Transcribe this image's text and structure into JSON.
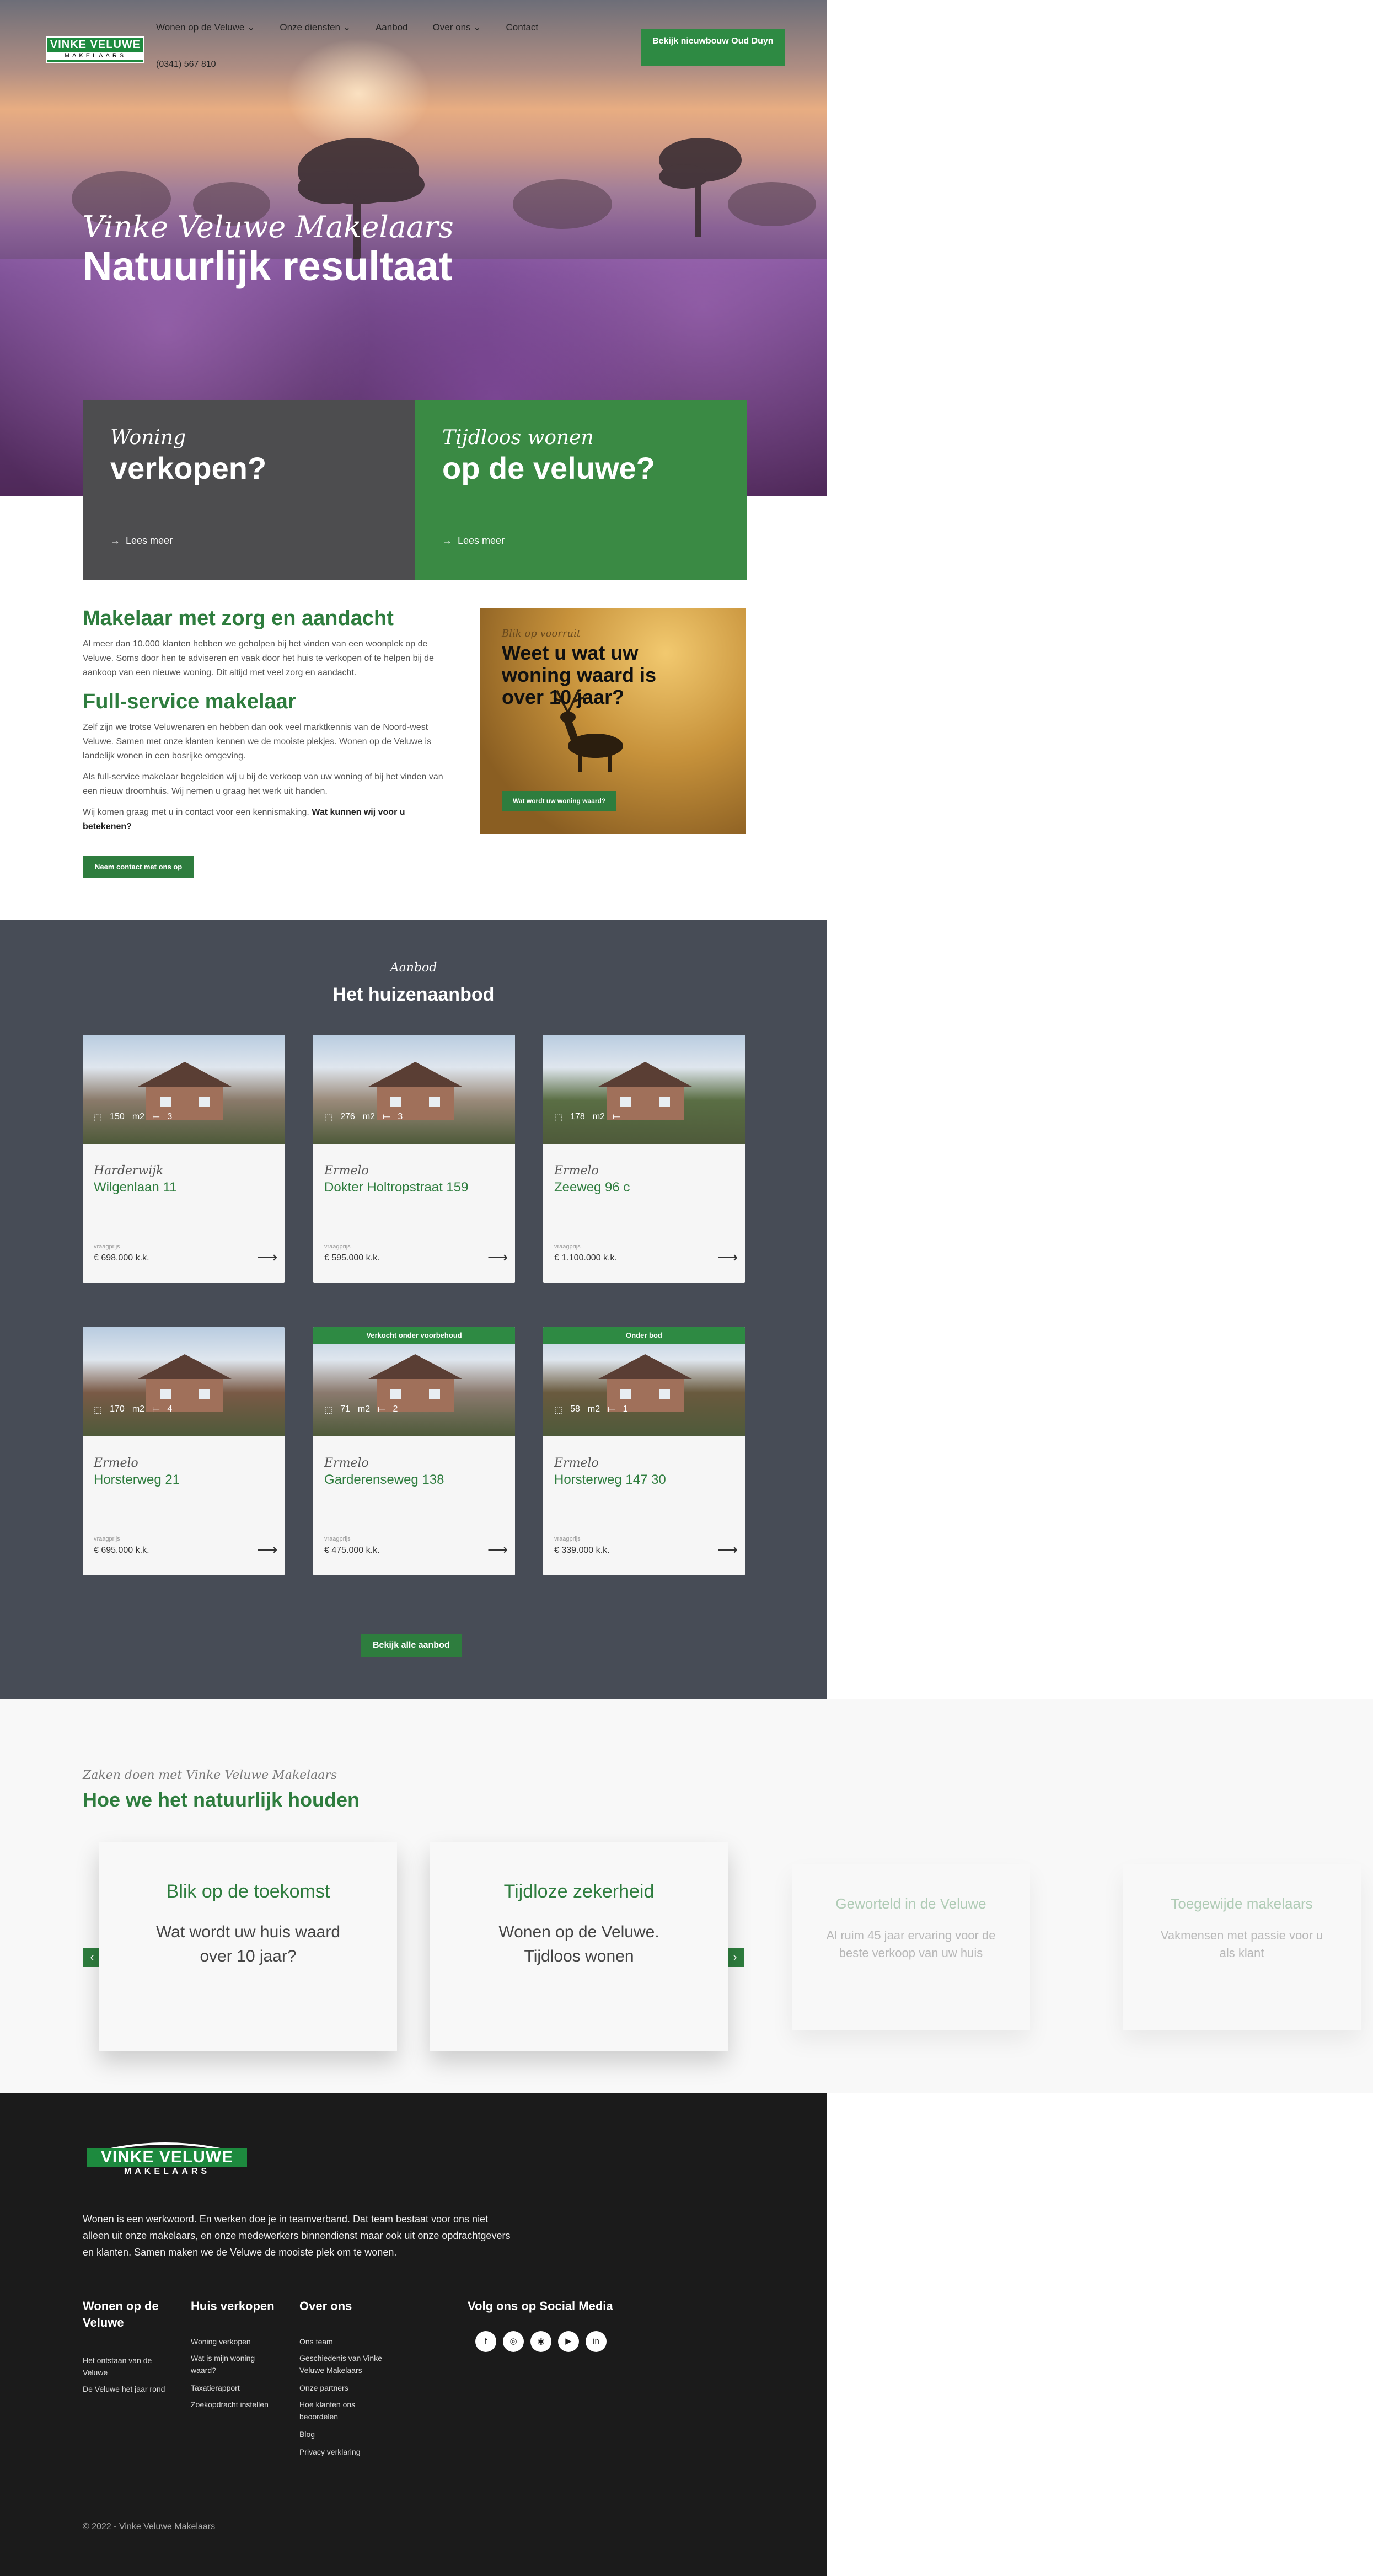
{
  "nav": {
    "logo": {
      "main": "VINKE VELUWE",
      "sub": "MAKELAARS"
    },
    "items": [
      "Wonen op de Veluwe",
      "Onze diensten",
      "Aanbod",
      "Over ons",
      "Contact"
    ],
    "phone": "(0341) 567 810",
    "cta": "Bekijk nieuwbouw Oud Duyn"
  },
  "hero": {
    "subtitle": "Vinke Veluwe Makelaars",
    "title": "Natuurlijk resultaat"
  },
  "boxes": [
    {
      "s": "Woning",
      "t": "verkopen?",
      "link": "Lees meer",
      "color": "#4d4d4f"
    },
    {
      "s": "Tijdloos wonen",
      "t": "op de veluwe?",
      "link": "Lees meer",
      "color": "#3a8a44"
    }
  ],
  "about": {
    "h1": "Makelaar met zorg en aandacht",
    "p1": "Al meer dan 10.000 klanten hebben we geholpen bij het vinden van een woonplek op de Veluwe. Soms door hen te adviseren en vaak door het huis te verkopen of te helpen bij de aankoop van een nieuwe woning. Dit altijd met veel zorg en aandacht.",
    "h2": "Full-service makelaar",
    "p2": "Zelf zijn we trotse Veluwenaren en hebben dan ook veel marktkennis van de Noord-west Veluwe. Samen met onze klanten kennen we de mooiste plekjes. Wonen op de Veluwe is landelijk wonen in een bosrijke omgeving.",
    "p3": "Als full-service makelaar begeleiden wij u bij de verkoop van uw woning of bij het vinden van een nieuw droomhuis. Wij nemen u graag het werk uit handen.",
    "p4a": "Wij komen graag met u in contact voor een kennismaking.",
    "p4b": "Wat kunnen wij voor u betekenen?",
    "btn": "Neem contact met ons op"
  },
  "promo": {
    "s": "Blik op voorruit",
    "t": "Weet u wat uw woning waard is over 10 jaar?",
    "btn": "Wat wordt uw woning waard?"
  },
  "aanbod": {
    "sub": "Aanbod",
    "title": "Het huizenaanbod",
    "vraagprijs": "vraagprijs",
    "unit": "m2",
    "btn": "Bekijk alle aanbod",
    "cards": [
      {
        "city": "Harderwijk",
        "street": "Wilgenlaan 11",
        "price": "€ 698.000 k.k.",
        "m2": "150",
        "rooms": "3",
        "label": "",
        "img": "#8a7a6a"
      },
      {
        "city": "Ermelo",
        "street": "Dokter Holtropstraat 159",
        "price": "€ 595.000 k.k.",
        "m2": "276",
        "rooms": "3",
        "label": "",
        "img": "#9a8a7a"
      },
      {
        "city": "Ermelo",
        "street": "Zeeweg 96 c",
        "price": "€ 1.100.000 k.k.",
        "m2": "178",
        "rooms": "",
        "label": "",
        "img": "#5a6e44"
      },
      {
        "city": "Ermelo",
        "street": "Horsterweg 21",
        "price": "€ 695.000 k.k.",
        "m2": "170",
        "rooms": "4",
        "label": "",
        "img": "#7a5a46"
      },
      {
        "city": "Ermelo",
        "street": "Garderenseweg 138",
        "price": "€ 475.000 k.k.",
        "m2": "71",
        "rooms": "2",
        "label": "Verkocht onder voorbehoud",
        "img": "#8b7a6e"
      },
      {
        "city": "Ermelo",
        "street": "Horsterweg 147 30",
        "price": "€ 339.000 k.k.",
        "m2": "58",
        "rooms": "1",
        "label": "Onder bod",
        "img": "#6a5a3e"
      }
    ]
  },
  "how": {
    "sub": "Zaken doen met Vinke Veluwe Makelaars",
    "title": "Hoe we het natuurlijk houden",
    "cards": [
      {
        "t": "Blik op de toekomst",
        "d": "Wat wordt uw huis waard over 10 jaar?"
      },
      {
        "t": "Tijdloze zekerheid",
        "d": "Wonen op de Veluwe. Tijdloos wonen"
      },
      {
        "t": "Geworteld in de Veluwe",
        "d": "Al ruim 45 jaar ervaring voor de beste verkoop van uw huis"
      },
      {
        "t": "Toegewijde makelaars",
        "d": "Vakmensen met passie voor u als klant"
      }
    ]
  },
  "footer": {
    "logo": {
      "main": "VINKE VELUWE",
      "sub": "MAKELAARS"
    },
    "intro": "Wonen is een werkwoord. En werken doe je in teamverband. Dat team bestaat voor ons niet alleen uit onze makelaars, en onze medewerkers binnendienst maar ook uit onze opdrachtgevers en klanten. Samen maken we de Veluwe de mooiste plek om te wonen.",
    "cols": [
      {
        "h": "Wonen op de Veluwe",
        "items": [
          "Het ontstaan van de Veluwe",
          "De Veluwe het jaar rond"
        ]
      },
      {
        "h": "Huis verkopen",
        "items": [
          "Woning verkopen",
          "Wat is mijn woning waard?",
          "Taxatierapport",
          "Zoekopdracht instellen"
        ]
      },
      {
        "h": "Over ons",
        "items": [
          "Ons team",
          "Geschiedenis van Vinke Veluwe Makelaars",
          "Onze partners",
          "Hoe klanten ons beoordelen",
          "Blog",
          "Privacy verklaring"
        ]
      }
    ],
    "social": "Volg ons op Social Media",
    "copyright": "© 2022 - Vinke Veluwe Makelaars"
  }
}
